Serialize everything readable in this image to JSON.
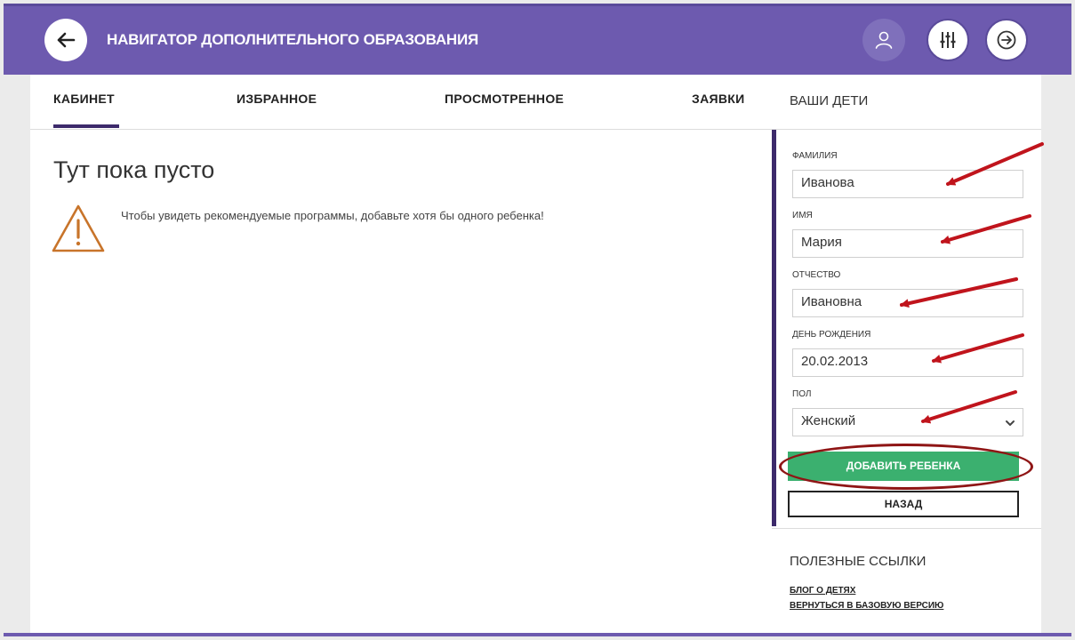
{
  "header": {
    "title": "НАВИГАТОР ДОПОЛНИТЕЛЬНОГО ОБРАЗОВАНИЯ",
    "back_icon": "arrow-left-icon",
    "profile_icon": "user-icon",
    "filter_icon": "sliders-icon",
    "logout_icon": "arrow-right-circle-icon"
  },
  "tabs": [
    {
      "label": "КАБИНЕТ",
      "active": true
    },
    {
      "label": "ИЗБРАННОЕ",
      "active": false
    },
    {
      "label": "ПРОСМОТРЕННОЕ",
      "active": false
    },
    {
      "label": "ЗАЯВКИ",
      "active": false
    }
  ],
  "main": {
    "empty_title": "Тут пока пусто",
    "warning_icon": "warning-triangle-icon",
    "warning_text": "Чтобы увидеть рекомендуемые программы, добавьте хотя бы одного ребенка!"
  },
  "sidebar": {
    "title": "ВАШИ ДЕТИ",
    "form": {
      "surname": {
        "label": "ФАМИЛИЯ",
        "value": "Иванова"
      },
      "name": {
        "label": "ИМЯ",
        "value": "Мария"
      },
      "patronymic": {
        "label": "ОТЧЕСТВО",
        "value": "Ивановна"
      },
      "birthday": {
        "label": "ДЕНЬ РОЖДЕНИЯ",
        "value": "20.02.2013"
      },
      "gender": {
        "label": "ПОЛ",
        "value": "Женский"
      },
      "add_button": "ДОБАВИТЬ РЕБЕНКА",
      "back_button": "НАЗАД"
    },
    "links": {
      "title": "ПОЛЕЗНЫЕ ССЫЛКИ",
      "items": [
        "БЛОГ О ДЕТЯХ",
        "ВЕРНУТЬСЯ В БАЗОВУЮ ВЕРСИЮ"
      ]
    }
  },
  "colors": {
    "header": "#6d5aaf",
    "accent": "#3d2a6b",
    "add_button": "#3bb06f",
    "annotation": "#c0141c",
    "warning": "#c8742a"
  }
}
